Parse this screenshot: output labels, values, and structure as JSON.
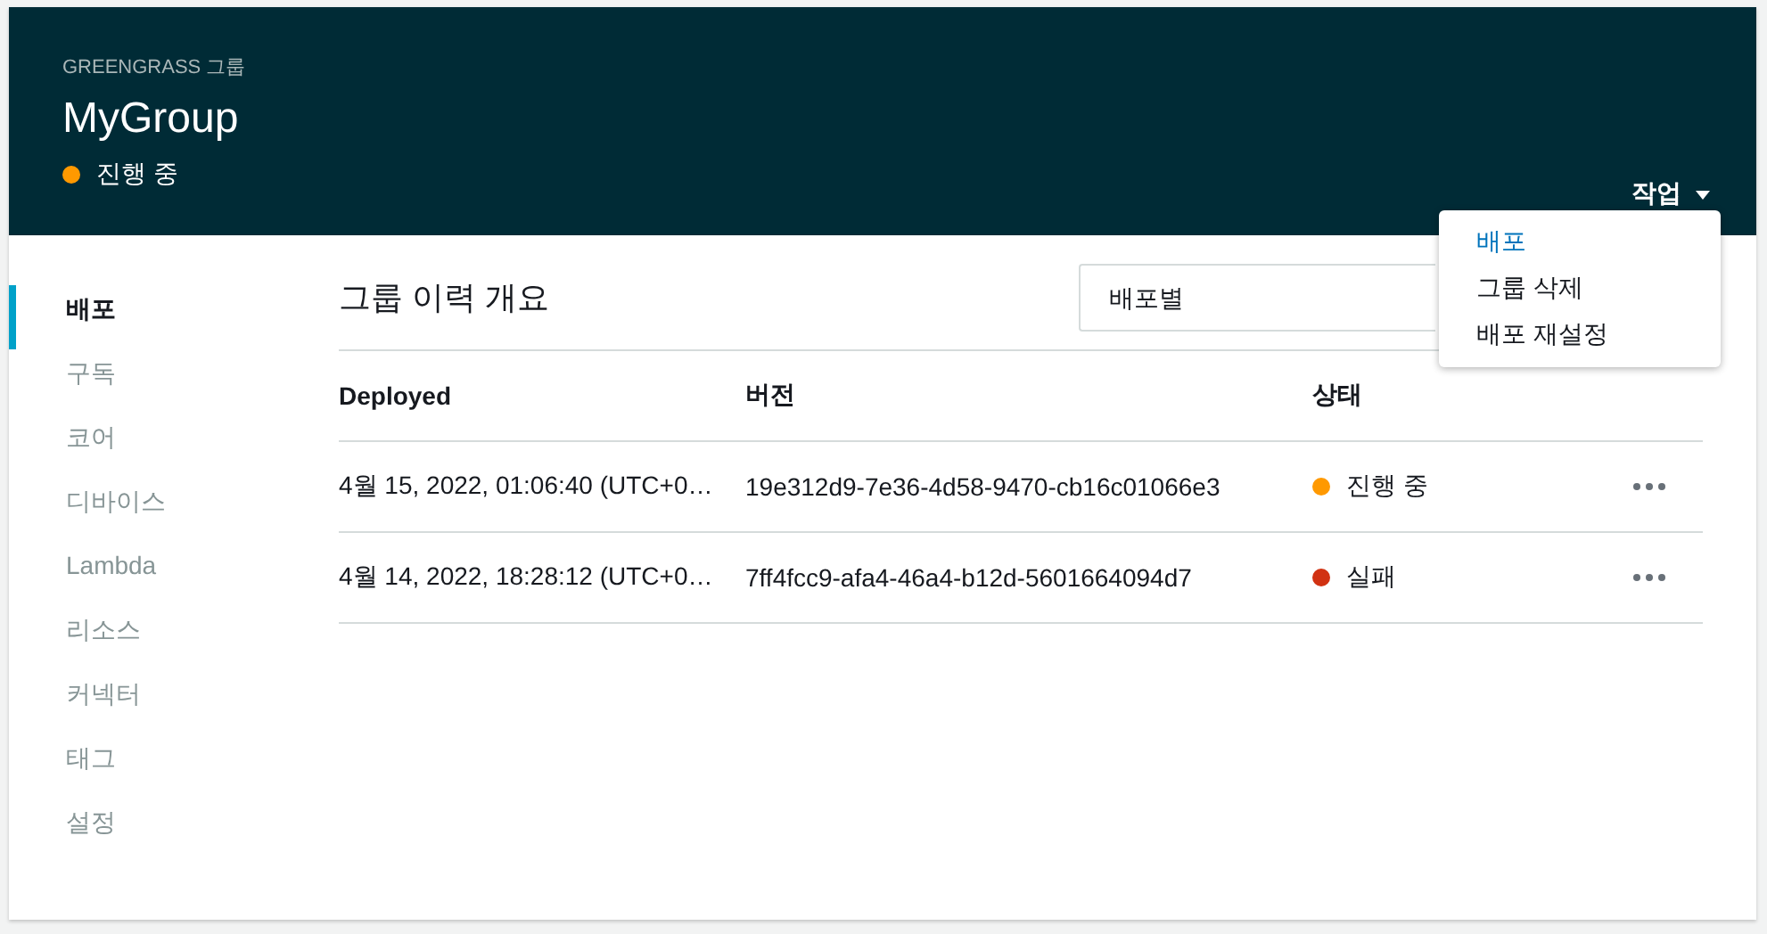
{
  "header": {
    "overline": "GREENGRASS 그룹",
    "title": "MyGroup",
    "status": {
      "label": "진행 중",
      "color": "#ff9900"
    },
    "actions_button": "작업"
  },
  "actions_menu": {
    "items": [
      "배포",
      "그룹 삭제",
      "배포 재설정"
    ]
  },
  "sidebar": {
    "items": [
      {
        "label": "배포",
        "selected": true
      },
      {
        "label": "구독",
        "selected": false
      },
      {
        "label": "코어",
        "selected": false
      },
      {
        "label": "디바이스",
        "selected": false
      },
      {
        "label": "Lambda",
        "selected": false
      },
      {
        "label": "리소스",
        "selected": false
      },
      {
        "label": "커넥터",
        "selected": false
      },
      {
        "label": "태그",
        "selected": false
      },
      {
        "label": "설정",
        "selected": false
      }
    ]
  },
  "main": {
    "title": "그룹 이력 개요",
    "filter_select": {
      "value": "배포별"
    },
    "table": {
      "columns": [
        "Deployed",
        "버전",
        "상태"
      ],
      "rows": [
        {
          "deployed": "4월 15, 2022, 01:06:40 (UTC+0…",
          "version": "19e312d9-7e36-4d58-9470-cb16c01066e3",
          "status": "진행 중",
          "color": "#ff9900"
        },
        {
          "deployed": "4월 14, 2022, 18:28:12 (UTC+0…",
          "version": "7ff4fcc9-afa4-46a4-b12d-5601664094d7",
          "status": "실패",
          "color": "#d13212"
        }
      ]
    }
  }
}
